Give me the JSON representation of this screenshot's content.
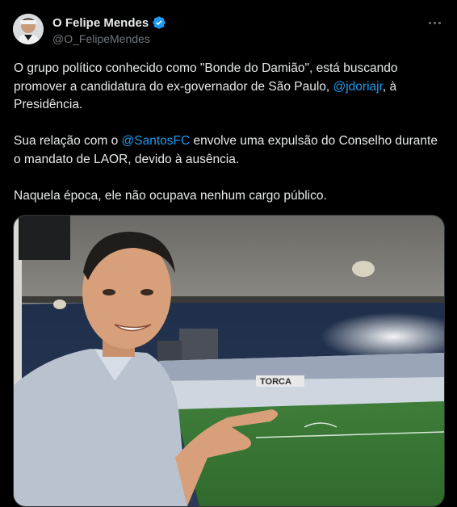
{
  "author": {
    "display_name": "O Felipe Mendes",
    "handle": "@O_FelipeMendes",
    "verified": true,
    "verified_color": "#1d9bf0"
  },
  "tweet": {
    "paragraph1": {
      "before": "O grupo político conhecido como \"Bonde do Damião\", está buscando promover a candidatura do ex-governador de São Paulo, ",
      "mention": "@jdoriajr",
      "after": ", à Presidência."
    },
    "paragraph2": {
      "before": "Sua relação com o ",
      "mention": "@SantosFC",
      "after": " envolve uma expulsão do Conselho durante o mandato de LAOR, devido à ausência."
    },
    "paragraph3": {
      "text": "Naquela época, ele não ocupava nenhum cargo público."
    }
  },
  "media": {
    "banner_text": "TORCA",
    "icon": "photo"
  },
  "icons": {
    "more": "more-horizontal-icon",
    "verified": "verified-badge-icon"
  },
  "colors": {
    "background": "#000000",
    "text": "#e7e9ea",
    "secondary": "#71767b",
    "link": "#1d9bf0"
  }
}
